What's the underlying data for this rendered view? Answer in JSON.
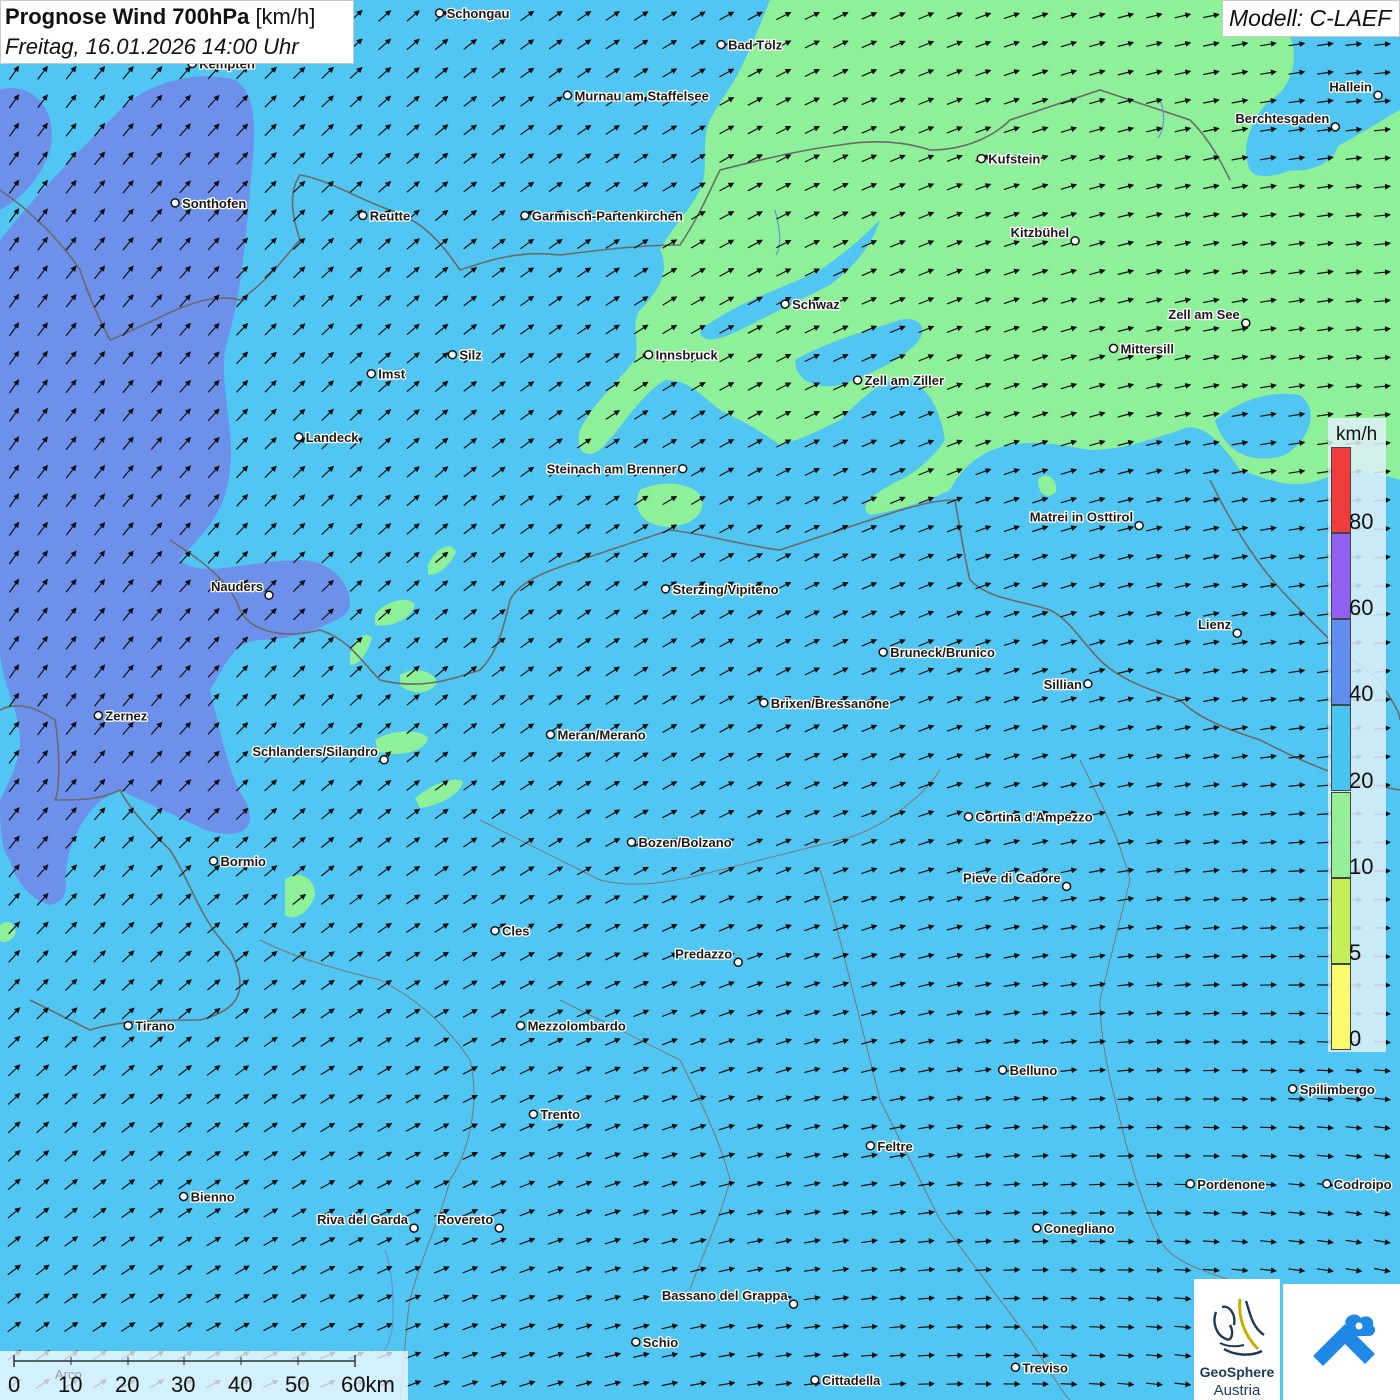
{
  "title": {
    "bold": "Prognose Wind 700hPa",
    "unit": "[km/h]",
    "date": "Freitag, 16.01.2026 14:00 Uhr"
  },
  "model": "Modell: C-LAEF",
  "legend": {
    "unit": "km/h",
    "steps": [
      {
        "label": "0",
        "color": "#fafa6e"
      },
      {
        "label": "5",
        "color": "#c3ef57"
      },
      {
        "label": "10",
        "color": "#96ee96"
      },
      {
        "label": "20",
        "color": "#48c6f0"
      },
      {
        "label": "40",
        "color": "#5f8ef0"
      },
      {
        "label": "60",
        "color": "#9160f0"
      },
      {
        "label": "80",
        "color": "#f03c3c"
      }
    ]
  },
  "scale_bar": {
    "labels": [
      "0",
      "10",
      "20",
      "30",
      "40",
      "50",
      "60km"
    ],
    "faint_label": "Arco"
  },
  "cities": [
    {
      "name": "Schongau",
      "lon": 10.9,
      "lat": 47.81
    },
    {
      "name": "Bad Tölz",
      "lon": 11.56,
      "lat": 47.76
    },
    {
      "name": "Kempten",
      "lon": 10.32,
      "lat": 47.73
    },
    {
      "name": "Murnau am Staffelsee",
      "lon": 11.2,
      "lat": 47.68
    },
    {
      "name": "Hallein",
      "lon": 13.1,
      "lat": 47.68
    },
    {
      "name": "Berchtesgaden",
      "lon": 13.0,
      "lat": 47.63
    },
    {
      "name": "Kufstein",
      "lon": 12.17,
      "lat": 47.58
    },
    {
      "name": "Sonthofen",
      "lon": 10.28,
      "lat": 47.51
    },
    {
      "name": "Reutte",
      "lon": 10.72,
      "lat": 47.49
    },
    {
      "name": "Garmisch-Partenkirchen",
      "lon": 11.1,
      "lat": 47.49
    },
    {
      "name": "Kitzbühel",
      "lon": 12.39,
      "lat": 47.45
    },
    {
      "name": "Schwaz",
      "lon": 11.71,
      "lat": 47.35
    },
    {
      "name": "Zell am See",
      "lon": 12.79,
      "lat": 47.32
    },
    {
      "name": "Innsbruck",
      "lon": 11.39,
      "lat": 47.27
    },
    {
      "name": "Mittersill",
      "lon": 12.48,
      "lat": 47.28
    },
    {
      "name": "Silz",
      "lon": 10.93,
      "lat": 47.27
    },
    {
      "name": "Imst",
      "lon": 10.74,
      "lat": 47.24
    },
    {
      "name": "Zell am Ziller",
      "lon": 11.88,
      "lat": 47.23
    },
    {
      "name": "Landeck",
      "lon": 10.57,
      "lat": 47.14
    },
    {
      "name": "Steinach am Brenner",
      "lon": 11.47,
      "lat": 47.09
    },
    {
      "name": "Matrei in Osttirol",
      "lon": 12.54,
      "lat": 47.0
    },
    {
      "name": "Nauders",
      "lon": 10.5,
      "lat": 46.89
    },
    {
      "name": "Sterzing/Vipiteno",
      "lon": 11.43,
      "lat": 46.9
    },
    {
      "name": "Lienz",
      "lon": 12.77,
      "lat": 46.83
    },
    {
      "name": "Bruneck/Brunico",
      "lon": 11.94,
      "lat": 46.8
    },
    {
      "name": "Sillian",
      "lon": 12.42,
      "lat": 46.75
    },
    {
      "name": "Brixen/Bressanone",
      "lon": 11.66,
      "lat": 46.72
    },
    {
      "name": "Zernez",
      "lon": 10.1,
      "lat": 46.7
    },
    {
      "name": "Meran/Merano",
      "lon": 11.16,
      "lat": 46.67
    },
    {
      "name": "Schlanders/Silandro",
      "lon": 10.77,
      "lat": 46.63
    },
    {
      "name": "Cortina d'Ampezzo",
      "lon": 12.14,
      "lat": 46.54
    },
    {
      "name": "Bozen/Bolzano",
      "lon": 11.35,
      "lat": 46.5
    },
    {
      "name": "Bormio",
      "lon": 10.37,
      "lat": 46.47
    },
    {
      "name": "Pieve di Cadore",
      "lon": 12.37,
      "lat": 46.43
    },
    {
      "name": "Cles",
      "lon": 11.03,
      "lat": 46.36
    },
    {
      "name": "Predazzo",
      "lon": 11.6,
      "lat": 46.31
    },
    {
      "name": "Tirano",
      "lon": 10.17,
      "lat": 46.21
    },
    {
      "name": "Mezzolombardo",
      "lon": 11.09,
      "lat": 46.21
    },
    {
      "name": "Belluno",
      "lon": 12.22,
      "lat": 46.14
    },
    {
      "name": "Spilimbergo",
      "lon": 12.9,
      "lat": 46.11
    },
    {
      "name": "Trento",
      "lon": 11.12,
      "lat": 46.07
    },
    {
      "name": "Feltre",
      "lon": 11.91,
      "lat": 46.02
    },
    {
      "name": "Pordenone",
      "lon": 12.66,
      "lat": 45.96
    },
    {
      "name": "Codroipo",
      "lon": 12.98,
      "lat": 45.96
    },
    {
      "name": "Bienno",
      "lon": 10.3,
      "lat": 45.94
    },
    {
      "name": "Riva del Garda",
      "lon": 10.84,
      "lat": 45.89
    },
    {
      "name": "Rovereto",
      "lon": 11.04,
      "lat": 45.89
    },
    {
      "name": "Conegliano",
      "lon": 12.3,
      "lat": 45.89
    },
    {
      "name": "Bassano del Grappa",
      "lon": 11.73,
      "lat": 45.77
    },
    {
      "name": "Schio",
      "lon": 11.36,
      "lat": 45.71
    },
    {
      "name": "Treviso",
      "lon": 12.25,
      "lat": 45.67
    },
    {
      "name": "Cittadella",
      "lon": 11.78,
      "lat": 45.65
    }
  ],
  "logo": {
    "line1": "GeoSphere",
    "line2": "Austria"
  }
}
